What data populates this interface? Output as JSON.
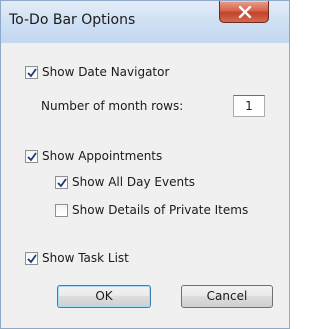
{
  "dialog": {
    "title": "To-Do Bar Options",
    "close_glyph": "X"
  },
  "options": {
    "show_date_navigator": {
      "label": "Show Date Navigator",
      "checked": true
    },
    "month_rows": {
      "label": "Number of month rows:",
      "value": "1"
    },
    "show_appointments": {
      "label": "Show Appointments",
      "checked": true
    },
    "show_all_day_events": {
      "label": "Show All Day Events",
      "checked": true
    },
    "show_private_details": {
      "label": "Show Details of Private Items",
      "checked": false
    },
    "show_task_list": {
      "label": "Show Task List",
      "checked": true
    }
  },
  "buttons": {
    "ok": "OK",
    "cancel": "Cancel"
  },
  "colors": {
    "close_button": "#c2442c",
    "check_mark": "#1f3a78",
    "focus_border": "#3c7fb1"
  },
  "icons": {
    "close": "close-icon",
    "check": "checkmark-icon"
  }
}
